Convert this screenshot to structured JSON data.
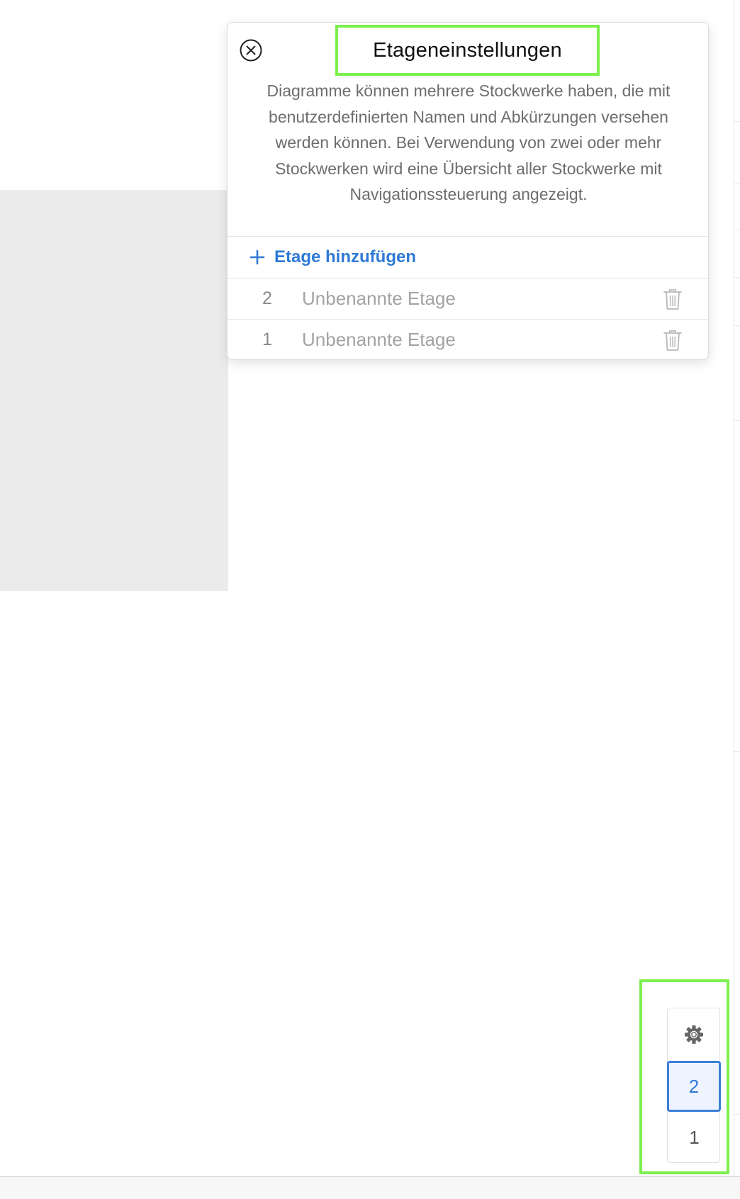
{
  "popover": {
    "title": "Etageneinstellungen",
    "description": "Diagramme können mehrere Stockwerke haben, die mit benutzerdefinierten Namen und Abkürzungen versehen werden können. Bei Verwendung von zwei oder mehr Stockwerken wird eine Übersicht aller Stockwerke mit Navigationssteuerung angezeigt.",
    "add_floor_label": "Etage hinzufügen",
    "floors": [
      {
        "number": "2",
        "name_placeholder": "Unbenannte Etage"
      },
      {
        "number": "1",
        "name_placeholder": "Unbenannte Etage"
      }
    ]
  },
  "floor_nav": {
    "active_floor": "2",
    "floors": [
      "2",
      "1"
    ]
  },
  "icons": {
    "close": "close-circle-icon",
    "add": "plus-icon",
    "delete": "trash-icon",
    "settings": "gear-icon"
  },
  "colors": {
    "accent": "#2f7ad6",
    "highlight": "#7cf14e",
    "placeholder_text": "#a3a3a3",
    "canvas_block": "#ebebeb"
  }
}
